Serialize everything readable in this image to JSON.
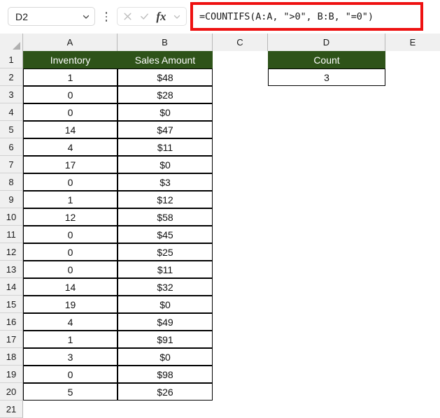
{
  "app": "excel-spreadsheet",
  "formula_bar": {
    "name_box_value": "D2",
    "name_box_chevron": "chevron-down-icon",
    "options_menu": "more-options-icon",
    "cancel_icon": "cancel-icon",
    "enter_icon": "enter-icon",
    "fx_label": "fx",
    "fx_chevron": "chevron-down-icon",
    "formula": "=COUNTIFS(A:A, \">0\", B:B, \"=0\")",
    "highlight_color": "#ee1111"
  },
  "grid": {
    "header_fill": "#2e5319",
    "header_text_color": "#ffffff",
    "columns": [
      "A",
      "B",
      "C",
      "D",
      "E"
    ],
    "row_numbers": [
      "1",
      "2",
      "3",
      "4",
      "5",
      "6",
      "7",
      "8",
      "9",
      "10",
      "11",
      "12",
      "13",
      "14",
      "15",
      "16",
      "17",
      "18",
      "19",
      "20",
      "21"
    ],
    "table_headers": {
      "a": "Inventory",
      "b": "Sales Amount",
      "d": "Count"
    },
    "result": {
      "label": "Count",
      "value": "3"
    },
    "rows": [
      {
        "row": "2",
        "inventory": "1",
        "sales": "$48"
      },
      {
        "row": "3",
        "inventory": "0",
        "sales": "$28"
      },
      {
        "row": "4",
        "inventory": "0",
        "sales": "$0"
      },
      {
        "row": "5",
        "inventory": "14",
        "sales": "$47"
      },
      {
        "row": "6",
        "inventory": "4",
        "sales": "$11"
      },
      {
        "row": "7",
        "inventory": "17",
        "sales": "$0"
      },
      {
        "row": "8",
        "inventory": "0",
        "sales": "$3"
      },
      {
        "row": "9",
        "inventory": "1",
        "sales": "$12"
      },
      {
        "row": "10",
        "inventory": "12",
        "sales": "$58"
      },
      {
        "row": "11",
        "inventory": "0",
        "sales": "$45"
      },
      {
        "row": "12",
        "inventory": "0",
        "sales": "$25"
      },
      {
        "row": "13",
        "inventory": "0",
        "sales": "$11"
      },
      {
        "row": "14",
        "inventory": "14",
        "sales": "$32"
      },
      {
        "row": "15",
        "inventory": "19",
        "sales": "$0"
      },
      {
        "row": "16",
        "inventory": "4",
        "sales": "$49"
      },
      {
        "row": "17",
        "inventory": "1",
        "sales": "$91"
      },
      {
        "row": "18",
        "inventory": "3",
        "sales": "$0"
      },
      {
        "row": "19",
        "inventory": "0",
        "sales": "$98"
      },
      {
        "row": "20",
        "inventory": "5",
        "sales": "$26"
      }
    ]
  }
}
